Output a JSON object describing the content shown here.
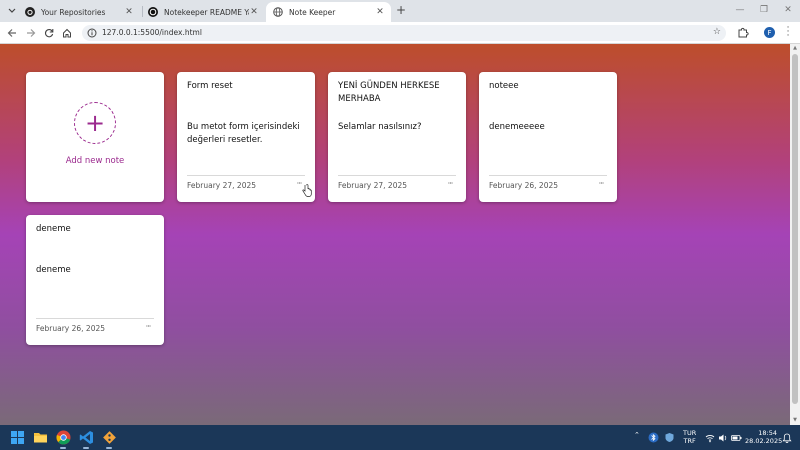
{
  "browser": {
    "tabs": [
      {
        "title": "Your Repositories",
        "icon": "github-icon",
        "active": false
      },
      {
        "title": "Notekeeper README Yardımı",
        "icon": "chatgpt-icon",
        "active": false
      },
      {
        "title": "Note Keeper",
        "icon": "globe-icon",
        "active": true
      }
    ],
    "url": "127.0.0.1:5500/index.html",
    "profile_initial": "F"
  },
  "app": {
    "add_note_label": "Add new note",
    "add_note_symbol": "+",
    "notes": [
      {
        "title": "Form reset",
        "description": "Bu metot form içerisindeki değerleri resetler.",
        "date": "February 27, 2025",
        "menu": "···"
      },
      {
        "title": "YENİ GÜNDEN HERKESE MERHABA",
        "description": "Selamlar nasılsınız?",
        "date": "February 27, 2025",
        "menu": "···"
      },
      {
        "title": "noteee",
        "description": "denemeeeee",
        "date": "February 26, 2025",
        "menu": "···"
      },
      {
        "title": "deneme",
        "description": "deneme",
        "date": "February 26, 2025",
        "menu": "···"
      }
    ]
  },
  "taskbar": {
    "apps": [
      "windows-start-icon",
      "file-explorer-icon",
      "chrome-icon",
      "vscode-icon",
      "git-icon"
    ],
    "language": "TUR",
    "keyboard": "TRF",
    "time": "18:54",
    "date": "28.02.2025"
  },
  "colors": {
    "accent": "#9b2a8e",
    "taskbar": "#1b3758",
    "gradient_top": "#bd4e2b",
    "gradient_mid": "#a543b6",
    "gradient_bottom": "#7a6a78"
  }
}
